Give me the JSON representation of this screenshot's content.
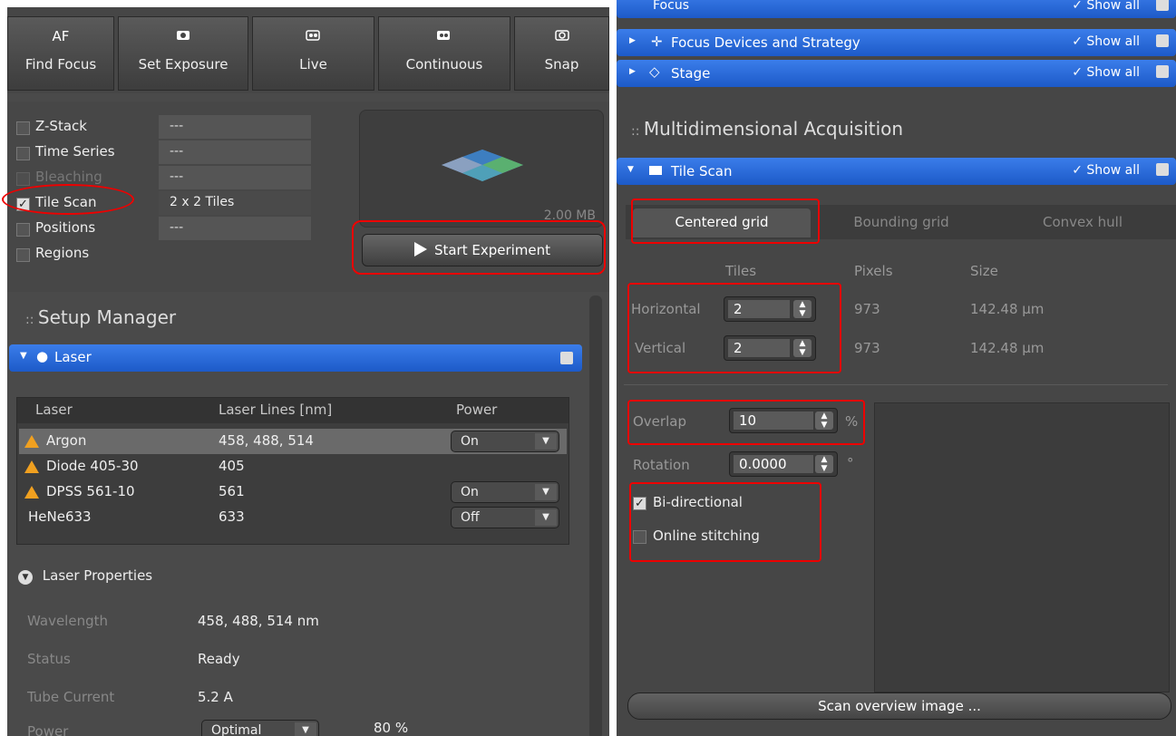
{
  "toolbar": {
    "buttons": [
      {
        "icon": "AF",
        "label": "Find Focus"
      },
      {
        "icon": "camera-icon",
        "label": "Set Exposure"
      },
      {
        "icon": "live-icon",
        "label": "Live"
      },
      {
        "icon": "continuous-icon",
        "label": "Continuous"
      },
      {
        "icon": "snap-icon",
        "label": "Snap"
      }
    ]
  },
  "acquisition": {
    "options": [
      {
        "label": "Z-Stack",
        "value": "---",
        "checked": false
      },
      {
        "label": "Time Series",
        "value": "---",
        "checked": false
      },
      {
        "label": "Bleaching",
        "value": "---",
        "checked": false
      },
      {
        "label": "Tile Scan",
        "value": "2 x 2 Tiles",
        "checked": true
      },
      {
        "label": "Positions",
        "value": "---",
        "checked": false
      },
      {
        "label": "Regions",
        "value": "",
        "checked": false
      }
    ],
    "preview_size": "2.00 MB",
    "start_label": "Start Experiment"
  },
  "setup_manager": {
    "title": "Setup Manager",
    "laser_panel_title": "Laser",
    "columns": [
      "Laser",
      "Laser Lines [nm]",
      "Power"
    ],
    "rows": [
      {
        "name": "Argon",
        "lines": "458, 488, 514",
        "power": "On",
        "warn": true
      },
      {
        "name": "Diode 405-30",
        "lines": "405",
        "power": "",
        "warn": true
      },
      {
        "name": "DPSS 561-10",
        "lines": "561",
        "power": "On",
        "warn": true
      },
      {
        "name": "HeNe633",
        "lines": "633",
        "power": "Off",
        "warn": false
      }
    ],
    "laser_properties_title": "Laser Properties",
    "properties": [
      {
        "label": "Wavelength",
        "value": "458, 488, 514 nm"
      },
      {
        "label": "Status",
        "value": "Ready"
      },
      {
        "label": "Tube Current",
        "value": "5.2 A"
      }
    ],
    "power_label": "Power",
    "power_mode": "Optimal",
    "power_percent": "80 %"
  },
  "right_panels": {
    "focus_label": "Focus",
    "focus_devices_label": "Focus Devices and Strategy",
    "stage_label": "Stage",
    "show_all": "Show all",
    "md_title": "Multidimensional Acquisition",
    "tile_scan_label": "Tile Scan"
  },
  "tile_scan": {
    "tabs": [
      "Centered grid",
      "Bounding grid",
      "Convex hull"
    ],
    "col_headers": [
      "Tiles",
      "Pixels",
      "Size"
    ],
    "horizontal": {
      "label": "Horizontal",
      "tiles": "2",
      "pixels": "973",
      "size": "142.48 µm"
    },
    "vertical": {
      "label": "Vertical",
      "tiles": "2",
      "pixels": "973",
      "size": "142.48 µm"
    },
    "overlap": {
      "label": "Overlap",
      "value": "10",
      "unit": "%"
    },
    "rotation": {
      "label": "Rotation",
      "value": "0.0000",
      "unit": "°"
    },
    "bidirectional": {
      "label": "Bi-directional",
      "checked": true
    },
    "online_stitching": {
      "label": "Online stitching",
      "checked": false
    },
    "scan_overview_label": "Scan overview image ..."
  }
}
